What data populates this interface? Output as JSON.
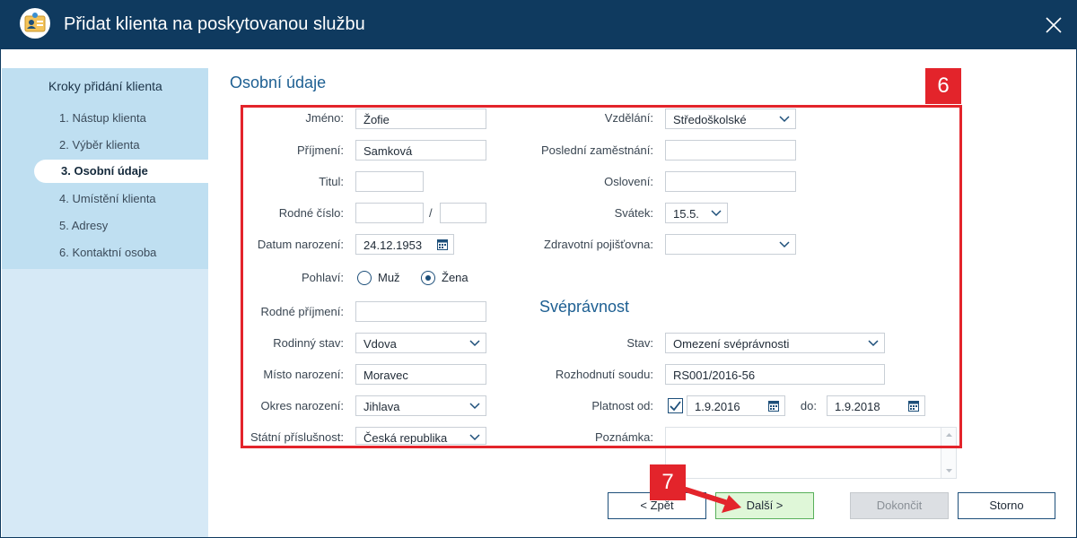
{
  "window": {
    "title": "Přidat klienta na poskytovanou službu",
    "icon": "client-card-icon",
    "close_icon": "close-icon"
  },
  "sidebar": {
    "heading": "Kroky přidání klienta",
    "steps": [
      {
        "label": "1. Nástup klienta",
        "active": false
      },
      {
        "label": "2. Výběr klienta",
        "active": false
      },
      {
        "label": "3. Osobní údaje",
        "active": true
      },
      {
        "label": "4. Umístění klienta",
        "active": false
      },
      {
        "label": "5. Adresy",
        "active": false
      },
      {
        "label": "6. Kontaktní osoba",
        "active": false
      }
    ]
  },
  "form": {
    "section_title": "Osobní údaje",
    "left": {
      "jmeno": {
        "label": "Jméno:",
        "value": "Žofie"
      },
      "prijmeni": {
        "label": "Příjmení:",
        "value": "Samková"
      },
      "titul": {
        "label": "Titul:",
        "value": ""
      },
      "rodne_cislo": {
        "label": "Rodné číslo:",
        "value1": "",
        "separator": "/",
        "value2": ""
      },
      "datum_narozeni": {
        "label": "Datum narození:",
        "value": "24.12.1953"
      },
      "pohlavi": {
        "label": "Pohlaví:",
        "options": [
          "Muž",
          "Žena"
        ],
        "selected": "Žena"
      },
      "rodne_prijmeni": {
        "label": "Rodné příjmení:",
        "value": ""
      },
      "rodinny_stav": {
        "label": "Rodinný stav:",
        "value": "Vdova"
      },
      "misto_narozeni": {
        "label": "Místo narození:",
        "value": "Moravec"
      },
      "okres_narozeni": {
        "label": "Okres narození:",
        "value": "Jihlava"
      },
      "statni_prislusnost": {
        "label": "Státní příslušnost:",
        "value": "Česká republika"
      }
    },
    "right": {
      "vzdelani": {
        "label": "Vzdělání:",
        "value": "Středoškolské"
      },
      "posledni_zamestnani": {
        "label": "Poslední zaměstnání:",
        "value": ""
      },
      "osloveni": {
        "label": "Oslovení:",
        "value": ""
      },
      "svatek": {
        "label": "Svátek:",
        "value": "15.5."
      },
      "pojistovna": {
        "label": "Zdravotní pojišťovna:",
        "value": ""
      }
    },
    "sveprav": {
      "title": "Svéprávnost",
      "stav": {
        "label": "Stav:",
        "value": "Omezení svéprávnosti"
      },
      "rozhodnuti": {
        "label": "Rozhodnutí soudu:",
        "value": "RS001/2016-56"
      },
      "platnost_od": {
        "label": "Platnost od:",
        "checked": true,
        "value": "1.9.2016"
      },
      "do": {
        "label": "do:",
        "value": "1.9.2018"
      },
      "poznamka": {
        "label": "Poznámka:",
        "value": ""
      }
    }
  },
  "annotations": {
    "box_number": "6",
    "arrow_number": "7",
    "color": "#e3242b"
  },
  "buttons": {
    "back": "< Zpět",
    "next": "Další >",
    "finish": "Dokončit",
    "cancel": "Storno"
  },
  "colors": {
    "titlebar": "#0f3a5f",
    "accent": "#1d5f92",
    "sidebar": "#d6e9f6",
    "primary_button": "#dff7d8"
  }
}
